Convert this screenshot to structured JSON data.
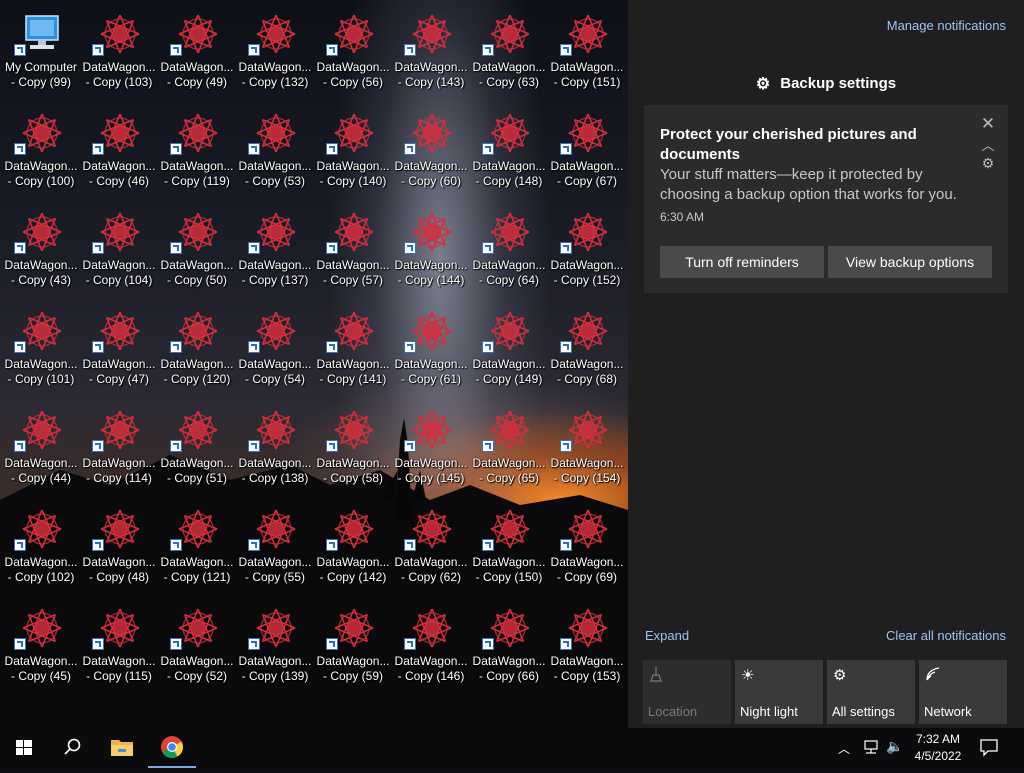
{
  "desktop": {
    "my_computer_label": "My Computer",
    "my_computer_overlap_label": "- Copy (99)",
    "icon_name": "DataWagon...",
    "grid": [
      [
        "- Copy (99)",
        "- Copy (103)",
        "- Copy (49)",
        "- Copy (132)",
        "- Copy (56)",
        "- Copy (143)",
        "- Copy (63)",
        "- Copy (151)"
      ],
      [
        "- Copy (100)",
        "- Copy (46)",
        "- Copy (119)",
        "- Copy (53)",
        "- Copy (140)",
        "- Copy (60)",
        "- Copy (148)",
        "- Copy (67)"
      ],
      [
        "- Copy (43)",
        "- Copy (104)",
        "- Copy (50)",
        "- Copy (137)",
        "- Copy (57)",
        "- Copy (144)",
        "- Copy (64)",
        "- Copy (152)"
      ],
      [
        "- Copy (101)",
        "- Copy (47)",
        "- Copy (120)",
        "- Copy (54)",
        "- Copy (141)",
        "- Copy (61)",
        "- Copy (149)",
        "- Copy (68)"
      ],
      [
        "- Copy (44)",
        "- Copy (114)",
        "- Copy (51)",
        "- Copy (138)",
        "- Copy (58)",
        "- Copy (145)",
        "- Copy (65)",
        "- Copy (154)"
      ],
      [
        "- Copy (102)",
        "- Copy (48)",
        "- Copy (121)",
        "- Copy (55)",
        "- Copy (142)",
        "- Copy (62)",
        "- Copy (150)",
        "- Copy (69)"
      ],
      [
        "- Copy (45)",
        "- Copy (115)",
        "- Copy (52)",
        "- Copy (139)",
        "- Copy (59)",
        "- Copy (146)",
        "- Copy (66)",
        "- Copy (153)"
      ]
    ],
    "icon_color": "#d32f3c"
  },
  "action_center": {
    "manage_notifications": "Manage notifications",
    "group_header": "Backup settings",
    "group_icon": "gear-icon",
    "toast": {
      "title": "Protect your cherished pictures and documents",
      "body": "Your stuff matters—keep it protected by choosing a backup option that works for you.",
      "time": "6:30 AM",
      "buttons": [
        "Turn off reminders",
        "View backup options"
      ]
    },
    "expand": "Expand",
    "clear_all": "Clear all notifications",
    "quick_actions": [
      {
        "label": "Location",
        "icon": "location-icon",
        "enabled": false
      },
      {
        "label": "Night light",
        "icon": "night-light-icon",
        "enabled": true
      },
      {
        "label": "All settings",
        "icon": "gear-icon",
        "enabled": true
      },
      {
        "label": "Network",
        "icon": "network-icon",
        "enabled": true
      }
    ]
  },
  "taskbar": {
    "time": "7:32 AM",
    "date": "4/5/2022",
    "pinned": [
      "start-icon",
      "search-icon",
      "file-explorer-icon",
      "chrome-icon"
    ],
    "accent": "#7fa9df"
  }
}
